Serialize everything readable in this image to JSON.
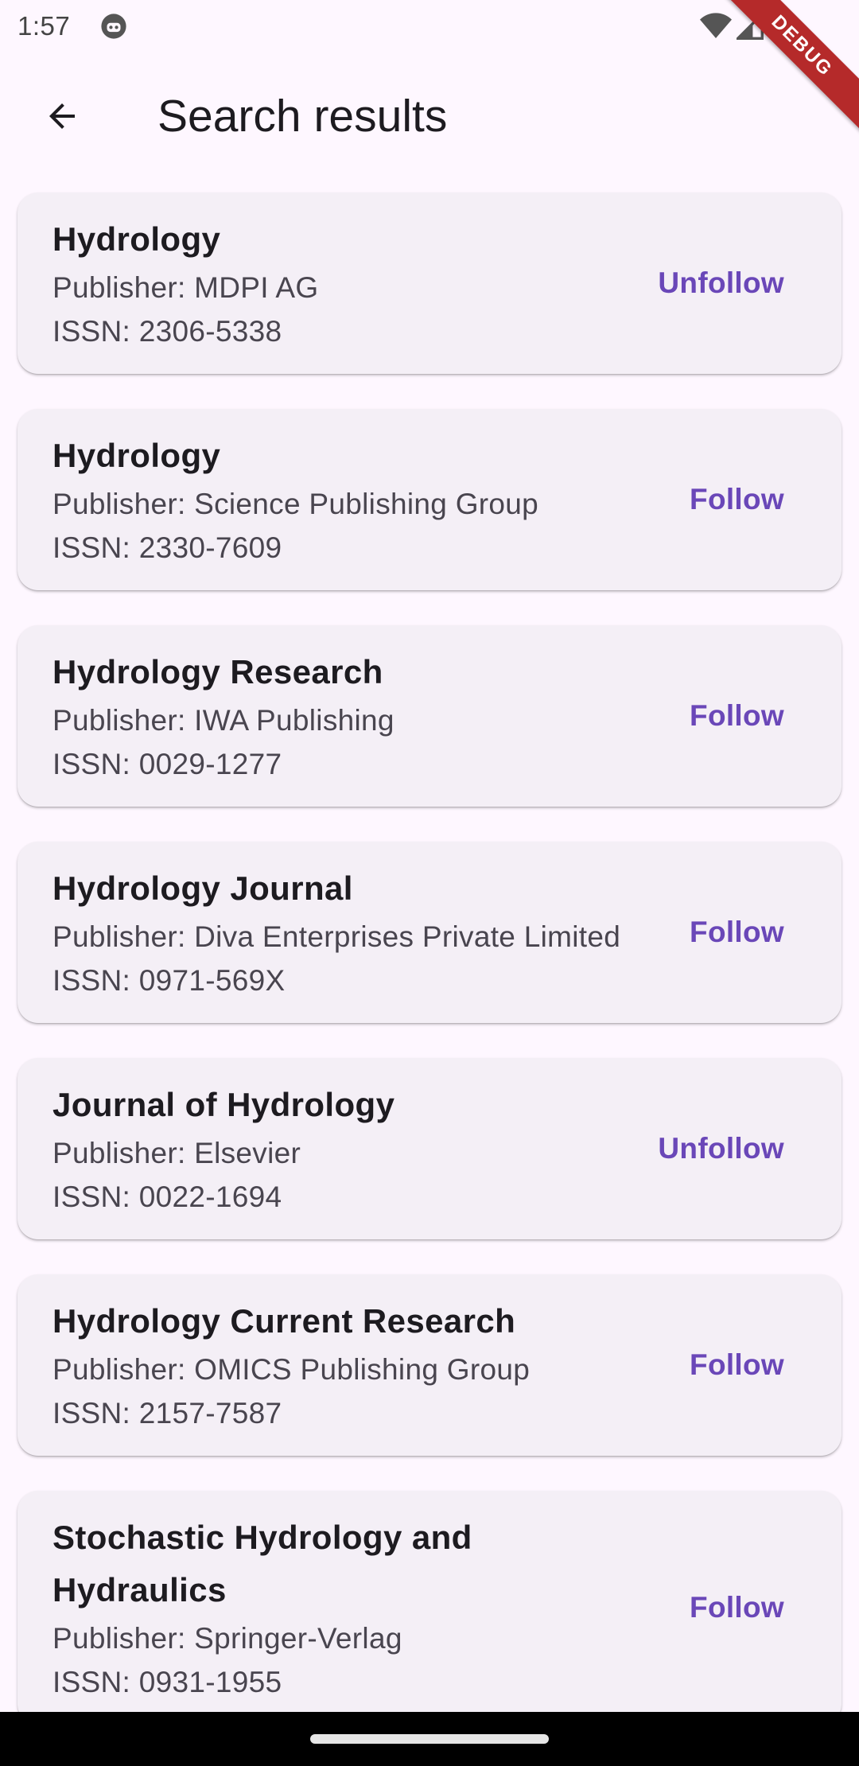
{
  "status_bar": {
    "time": "1:57",
    "icons": [
      "robot-icon",
      "wifi-icon",
      "signal-icon"
    ]
  },
  "debug_banner": "DEBUG",
  "app_bar": {
    "back_icon": "arrow-back-icon",
    "title": "Search results"
  },
  "results": [
    {
      "title": "Hydrology",
      "publisher": "Publisher: MDPI AG",
      "issn": "ISSN: 2306-5338",
      "action": "Unfollow"
    },
    {
      "title": "Hydrology",
      "publisher": "Publisher: Science Publishing Group",
      "issn": "ISSN: 2330-7609",
      "action": "Follow"
    },
    {
      "title": "Hydrology Research",
      "publisher": "Publisher: IWA Publishing",
      "issn": "ISSN: 0029-1277",
      "action": "Follow"
    },
    {
      "title": "Hydrology Journal",
      "publisher": "Publisher: Diva Enterprises Private Limited",
      "issn": "ISSN: 0971-569X",
      "action": "Follow"
    },
    {
      "title": "Journal of Hydrology",
      "publisher": "Publisher: Elsevier",
      "issn": "ISSN: 0022-1694",
      "action": "Unfollow"
    },
    {
      "title": "Hydrology Current Research",
      "publisher": "Publisher: OMICS Publishing Group",
      "issn": "ISSN: 2157-7587",
      "action": "Follow"
    },
    {
      "title": "Stochastic Hydrology and Hydraulics",
      "publisher": "Publisher: Springer-Verlag",
      "issn": "ISSN: 0931-1955",
      "action": "Follow"
    }
  ],
  "colors": {
    "background": "#fef7ff",
    "card": "#f4eff6",
    "accent": "#6a47b8",
    "debug": "#b52a2a"
  }
}
